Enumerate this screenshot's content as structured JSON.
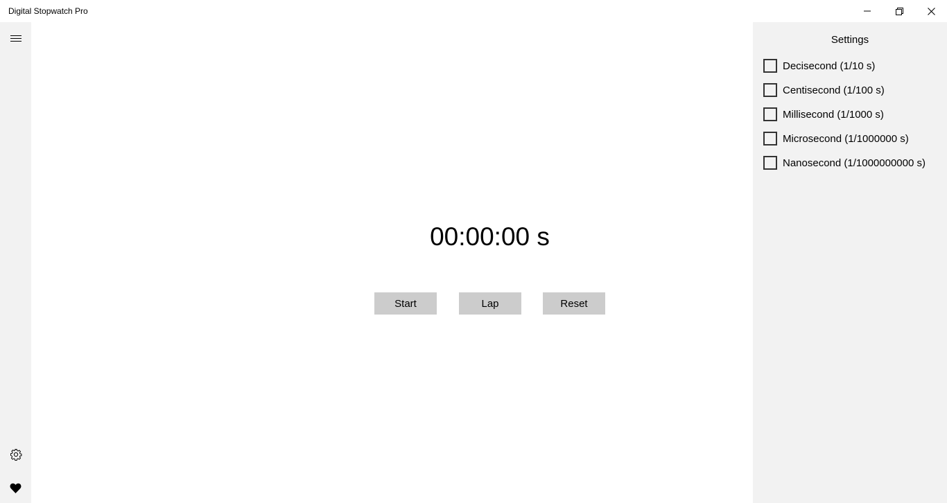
{
  "window": {
    "title": "Digital Stopwatch Pro"
  },
  "rail": {
    "menu_icon": "hamburger-icon",
    "settings_icon": "gear-icon",
    "favorite_icon": "heart-icon"
  },
  "stopwatch": {
    "display": "00:00:00 s",
    "start_label": "Start",
    "lap_label": "Lap",
    "reset_label": "Reset"
  },
  "settings": {
    "title": "Settings",
    "options": [
      {
        "label": "Decisecond (1/10 s)",
        "checked": false
      },
      {
        "label": "Centisecond (1/100 s)",
        "checked": false
      },
      {
        "label": "Millisecond (1/1000 s)",
        "checked": false
      },
      {
        "label": "Microsecond (1/1000000 s)",
        "checked": false
      },
      {
        "label": "Nanosecond (1/1000000000 s)",
        "checked": false
      }
    ]
  },
  "colors": {
    "panel_bg": "#f2f2f2",
    "button_bg": "#cccccc",
    "text": "#000000"
  }
}
